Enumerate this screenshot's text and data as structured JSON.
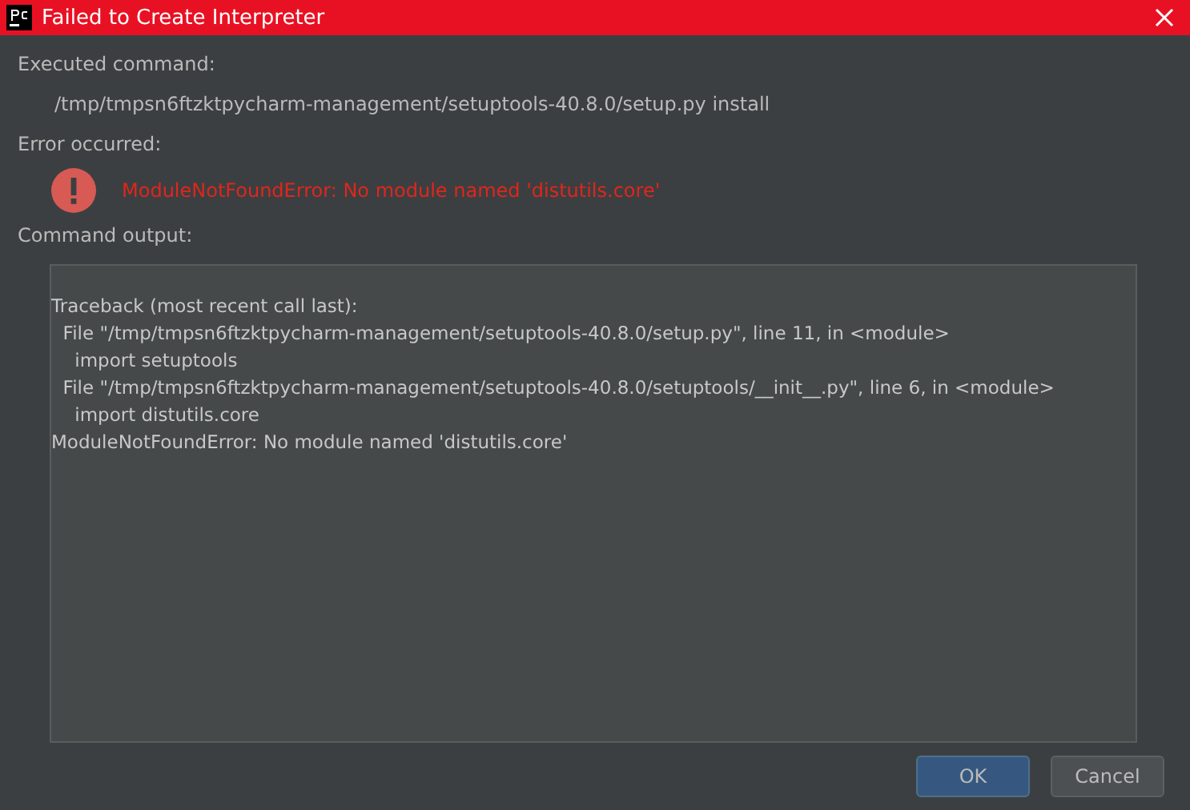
{
  "window": {
    "title": "Failed to Create Interpreter"
  },
  "executed_command": {
    "label": "Executed command:",
    "value": "/tmp/tmpsn6ftzktpycharm-management/setuptools-40.8.0/setup.py install"
  },
  "error": {
    "label": "Error occurred:",
    "message": "ModuleNotFoundError: No module named 'distutils.core'"
  },
  "output": {
    "label": "Command output:",
    "lines": [
      "Traceback (most recent call last):",
      "  File \"/tmp/tmpsn6ftzktpycharm-management/setuptools-40.8.0/setup.py\", line 11, in <module>",
      "    import setuptools",
      "  File \"/tmp/tmpsn6ftzktpycharm-management/setuptools-40.8.0/setuptools/__init__.py\", line 6, in <module>",
      "    import distutils.core",
      "ModuleNotFoundError: No module named 'distutils.core'"
    ]
  },
  "buttons": [
    {
      "label": "OK",
      "kind": "default"
    },
    {
      "label": "Cancel",
      "kind": "normal"
    }
  ]
}
